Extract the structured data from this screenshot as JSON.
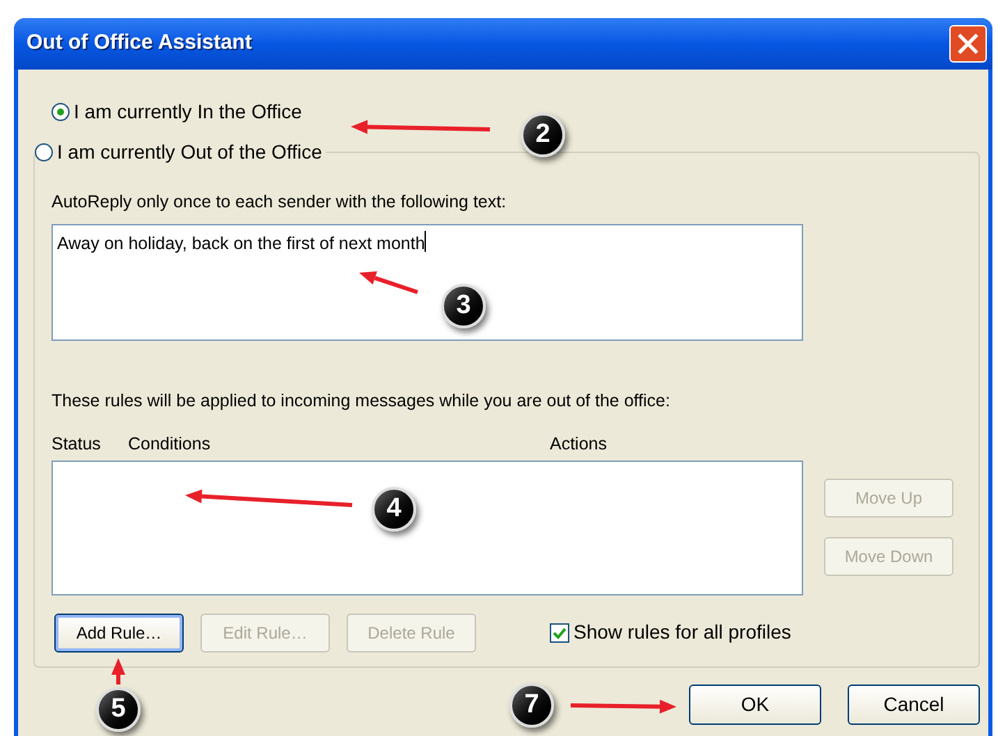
{
  "window": {
    "title": "Out of Office Assistant"
  },
  "status_options": [
    {
      "label": "I am currently In the Office",
      "selected": true
    },
    {
      "label": "I am currently Out of the Office",
      "selected": false
    }
  ],
  "autoreply": {
    "label": "AutoReply only once to each sender with the following text:",
    "value": "Away on holiday, back on the first of next month"
  },
  "rules": {
    "label": "These rules will be applied to incoming messages while you are out of the office:",
    "columns": [
      "Status",
      "Conditions",
      "Actions"
    ]
  },
  "side_buttons": [
    {
      "label": "Move Up",
      "disabled": true
    },
    {
      "label": "Move Down",
      "disabled": true
    }
  ],
  "rule_buttons": [
    {
      "label": "Add Rule…",
      "disabled": false
    },
    {
      "label": "Edit Rule…",
      "disabled": true
    },
    {
      "label": "Delete Rule",
      "disabled": true
    }
  ],
  "show_all_profiles": {
    "label": "Show rules for all profiles",
    "checked": true
  },
  "dialog_buttons": [
    {
      "label": "OK"
    },
    {
      "label": "Cancel"
    }
  ],
  "callouts": [
    {
      "number": "2"
    },
    {
      "number": "3"
    },
    {
      "number": "4"
    },
    {
      "number": "5"
    },
    {
      "number": "7"
    }
  ]
}
